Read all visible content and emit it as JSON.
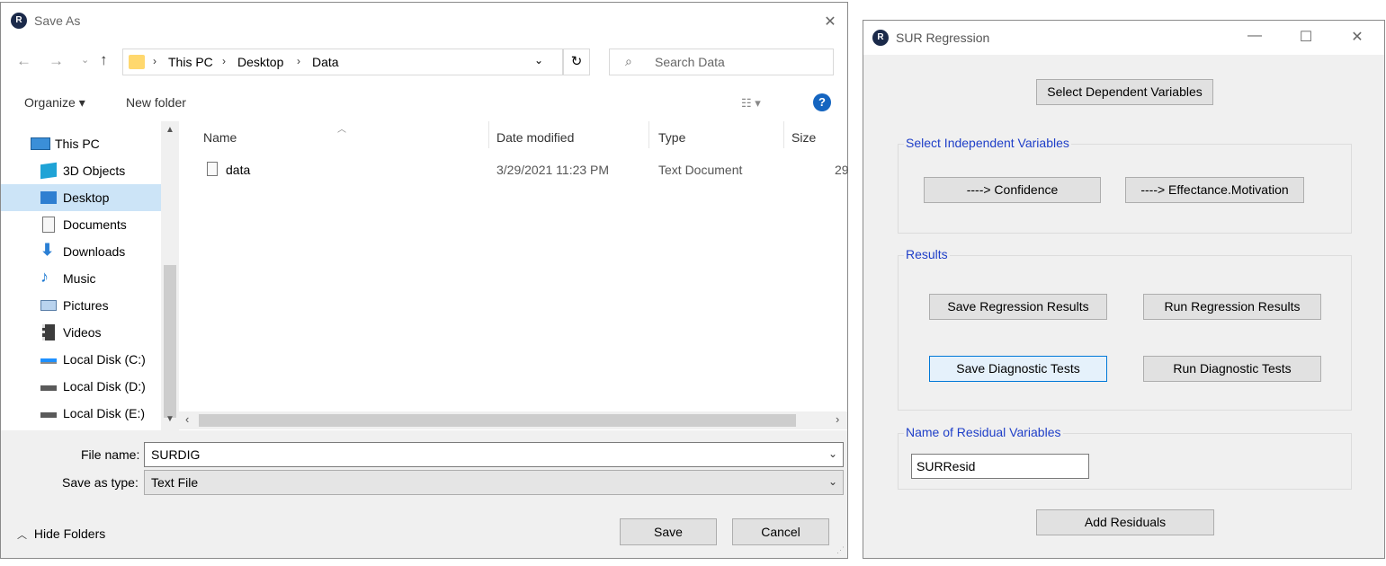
{
  "save_as": {
    "title": "Save As",
    "address": {
      "crumbs": [
        "This PC",
        "Desktop",
        "Data"
      ]
    },
    "search": {
      "placeholder": "Search Data"
    },
    "toolbar": {
      "organize": "Organize ▾",
      "new_folder": "New folder",
      "help": "?"
    },
    "nav_items": [
      {
        "label": "This PC",
        "icon": "computer-icon"
      },
      {
        "label": "3D Objects",
        "icon": "cube-icon"
      },
      {
        "label": "Desktop",
        "icon": "desktop-icon",
        "selected": true
      },
      {
        "label": "Documents",
        "icon": "document-icon"
      },
      {
        "label": "Downloads",
        "icon": "download-arrow-icon"
      },
      {
        "label": "Music",
        "icon": "music-note-icon"
      },
      {
        "label": "Pictures",
        "icon": "picture-icon"
      },
      {
        "label": "Videos",
        "icon": "film-icon"
      },
      {
        "label": "Local Disk (C:)",
        "icon": "windows-drive-icon"
      },
      {
        "label": "Local Disk (D:)",
        "icon": "drive-icon"
      },
      {
        "label": "Local Disk (E:)",
        "icon": "drive-icon"
      }
    ],
    "columns": [
      "Name",
      "Date modified",
      "Type",
      "Size"
    ],
    "files": [
      {
        "name": "data",
        "date": "3/29/2021 11:23 PM",
        "type": "Text Document",
        "size": "29"
      }
    ],
    "file_name": {
      "label": "File name:",
      "value": "SURDIG"
    },
    "save_type": {
      "label": "Save as type:",
      "value": "Text File"
    },
    "hide_folders": "Hide Folders",
    "save_button": "Save",
    "cancel_button": "Cancel"
  },
  "sur": {
    "title": "SUR Regression",
    "select_dependent": "Select Dependent Variables",
    "independent_group": {
      "title": "Select Independent Variables",
      "buttons": [
        "----> Confidence",
        "----> Effectance.Motivation"
      ]
    },
    "results_group": {
      "title": "Results",
      "save_regression": "Save Regression Results",
      "run_regression": "Run Regression Results",
      "save_diagnostic": "Save Diagnostic Tests",
      "run_diagnostic": "Run Diagnostic Tests"
    },
    "residual_group": {
      "title": "Name of Residual Variables",
      "value": "SURResid"
    },
    "add_residuals": "Add Residuals"
  },
  "colors": {
    "accent": "#0078d7",
    "group_title": "#1f3fc8",
    "selected_nav": "#cce4f7"
  }
}
